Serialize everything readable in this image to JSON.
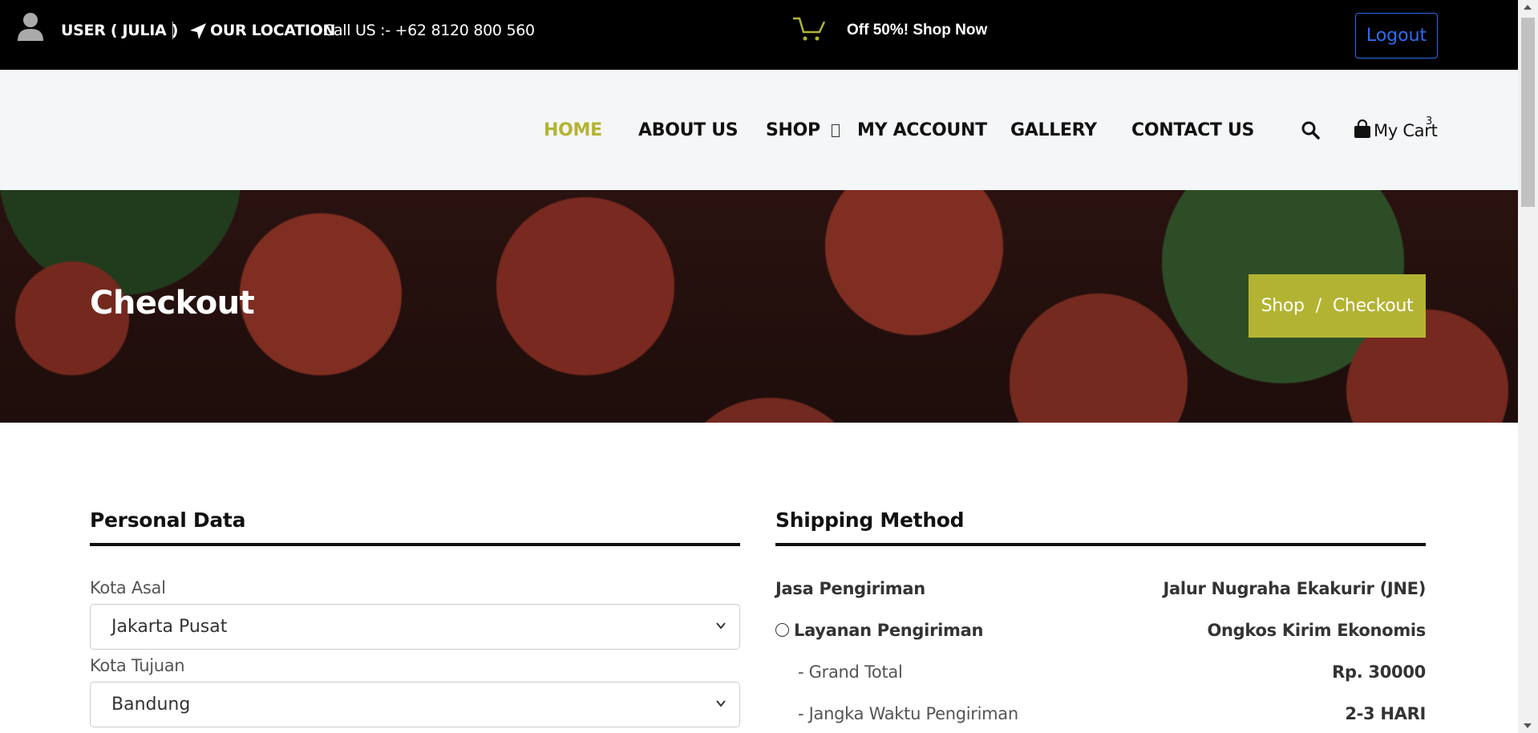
{
  "topbar": {
    "user_label": "USER ( JULIA )",
    "location_label": "OUR LOCATION",
    "call_label": "Call US :- +62 8120 800 560",
    "promo_label": "Off 50%! Shop Now",
    "logout_label": "Logout",
    "icons": [
      "user-icon",
      "location-arrow-icon",
      "cart-promo-icon"
    ]
  },
  "nav": {
    "items": [
      {
        "label": "HOME",
        "active": true
      },
      {
        "label": "ABOUT US",
        "active": false
      },
      {
        "label": "SHOP",
        "active": false
      },
      {
        "label": "MY ACCOUNT",
        "active": false
      },
      {
        "label": "GALLERY",
        "active": false
      },
      {
        "label": "CONTACT US",
        "active": false
      }
    ],
    "cart_label": "My Cart",
    "cart_count": "3"
  },
  "banner": {
    "title": "Checkout",
    "breadcrumb": {
      "link": "Shop",
      "separator": "/",
      "current": "Checkout"
    }
  },
  "personal": {
    "title": "Personal Data",
    "origin_label": "Kota Asal",
    "origin_value": "Jakarta Pusat",
    "destination_label": "Kota Tujuan",
    "destination_value": "Bandung"
  },
  "shipping": {
    "title": "Shipping Method",
    "courier_label": "Jasa Pengiriman",
    "courier_value": "Jalur Nugraha Ekakurir (JNE)",
    "service_label": "Layanan Pengiriman",
    "service_value": "Ongkos Kirim Ekonomis",
    "total_label": "-   Grand Total",
    "total_value": "Rp. 30000",
    "eta_label": "- Jangka Waktu Pengiriman",
    "eta_value": "2-3 HARI"
  },
  "colors": {
    "accent": "#b3b333",
    "topbar_bg": "#000000",
    "logout_blue": "#2d6cf0",
    "nav_bg": "#f5f6f8"
  }
}
